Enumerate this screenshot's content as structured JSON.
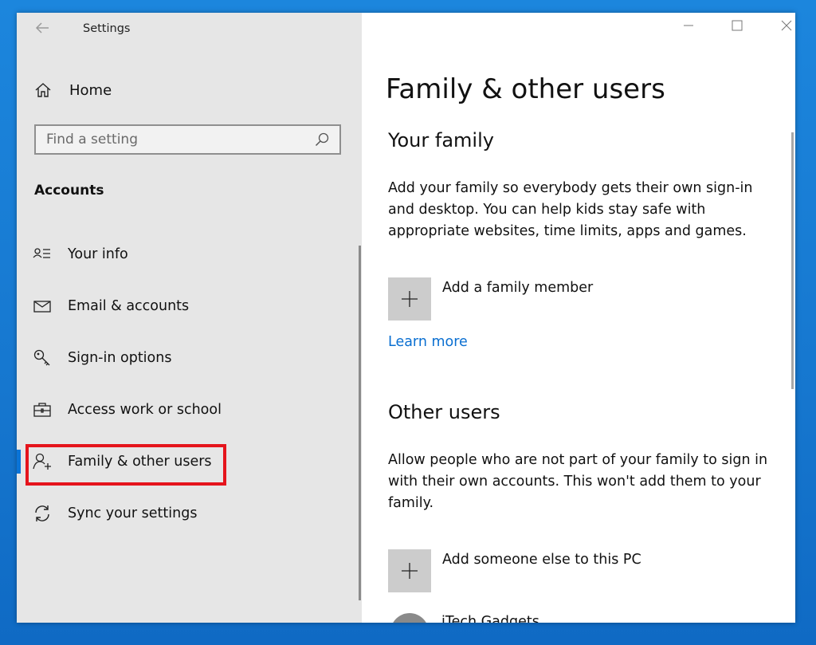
{
  "window": {
    "title": "Settings"
  },
  "sidebar": {
    "home_label": "Home",
    "search": {
      "placeholder": "Find a setting"
    },
    "section_title": "Accounts",
    "items": [
      {
        "label": "Your info",
        "icon": "contact-info-icon"
      },
      {
        "label": "Email & accounts",
        "icon": "mail-icon"
      },
      {
        "label": "Sign-in options",
        "icon": "key-icon"
      },
      {
        "label": "Access work or school",
        "icon": "briefcase-icon"
      },
      {
        "label": "Family & other users",
        "icon": "add-person-icon",
        "selected": true
      },
      {
        "label": "Sync your settings",
        "icon": "sync-icon"
      }
    ]
  },
  "main": {
    "title": "Family & other users",
    "your_family": {
      "heading": "Your family",
      "description": "Add your family so everybody gets their own sign-in and desktop. You can help kids stay safe with appropriate websites, time limits, apps and games.",
      "add_label": "Add a family member",
      "learn_more": "Learn more"
    },
    "other_users": {
      "heading": "Other users",
      "description": "Allow people who are not part of your family to sign in with their own accounts. This won't add them to your family.",
      "add_label": "Add someone else to this PC",
      "user_name": "iTech Gadgets"
    }
  },
  "colors": {
    "accent": "#0a74d8",
    "highlight_box": "#e5141c",
    "sidebar_bg": "#e6e6e6",
    "link": "#0a6fd1"
  }
}
